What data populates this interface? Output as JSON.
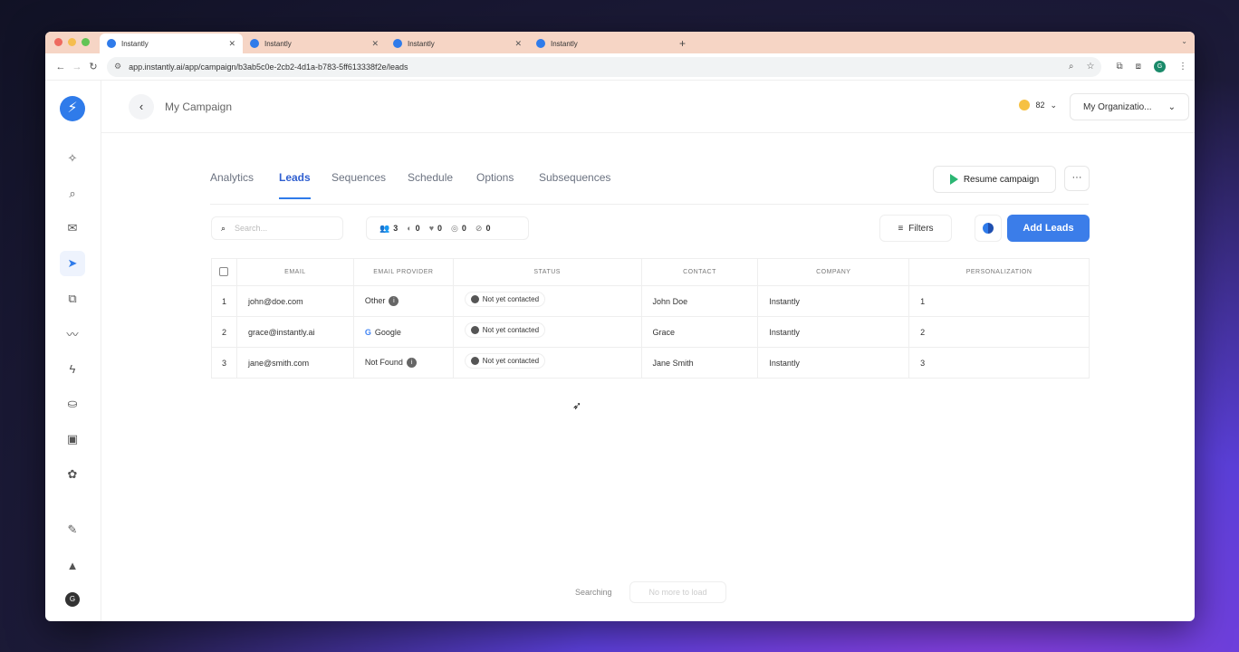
{
  "browser": {
    "tabs": [
      {
        "title": "Instantly",
        "active": true
      },
      {
        "title": "Instantly",
        "active": false
      },
      {
        "title": "Instantly",
        "active": false
      },
      {
        "title": "Instantly",
        "active": false
      }
    ],
    "url": "app.instantly.ai/app/campaign/b3ab5c0e-2cb2-4d1a-b783-5ff613338f2e/leads",
    "profile_initial": "G"
  },
  "sidebar": {
    "items": [
      {
        "icon": "sparkle-icon",
        "active": false
      },
      {
        "icon": "search-icon",
        "active": false
      },
      {
        "icon": "mail-icon",
        "active": false
      },
      {
        "icon": "send-icon",
        "active": true
      },
      {
        "icon": "copy-icon",
        "active": false
      },
      {
        "icon": "trend-icon",
        "active": false
      },
      {
        "icon": "bolt-icon",
        "active": false
      },
      {
        "icon": "ufo-icon",
        "active": false
      },
      {
        "icon": "inbox-icon",
        "active": false
      },
      {
        "icon": "apps-icon",
        "active": false
      },
      {
        "icon": "chat-edit-icon",
        "active": false
      },
      {
        "icon": "rocket-icon",
        "active": false
      }
    ],
    "avatar_initial": "G"
  },
  "header": {
    "title": "My Campaign",
    "credits": "82",
    "org": "My Organizatio..."
  },
  "tabs": [
    "Analytics",
    "Leads",
    "Sequences",
    "Schedule",
    "Options",
    "Subsequences"
  ],
  "active_tab": "Leads",
  "actions": {
    "resume": "Resume campaign",
    "filters": "Filters",
    "add_leads": "Add Leads"
  },
  "search": {
    "placeholder": "Search..."
  },
  "counts": [
    "3",
    "0",
    "0",
    "0",
    "0"
  ],
  "table": {
    "columns": [
      "EMAIL",
      "EMAIL PROVIDER",
      "STATUS",
      "CONTACT",
      "COMPANY",
      "PERSONALIZATION"
    ],
    "rows": [
      {
        "n": "1",
        "email": "john@doe.com",
        "provider": "Other",
        "status": "Not yet contacted",
        "contact": "John Doe",
        "company": "Instantly",
        "personalization": "1"
      },
      {
        "n": "2",
        "email": "grace@instantly.ai",
        "provider": "Google",
        "status": "Not yet contacted",
        "contact": "Grace",
        "company": "Instantly",
        "personalization": "2"
      },
      {
        "n": "3",
        "email": "jane@smith.com",
        "provider": "Not Found",
        "status": "Not yet contacted",
        "contact": "Jane Smith",
        "company": "Instantly",
        "personalization": "3"
      }
    ]
  },
  "footer": {
    "searching": "Searching",
    "no_more": "No more to load"
  },
  "colors": {
    "accent": "#3b7de9",
    "play": "#2bb673",
    "tabstrip": "#f6d5c5"
  }
}
